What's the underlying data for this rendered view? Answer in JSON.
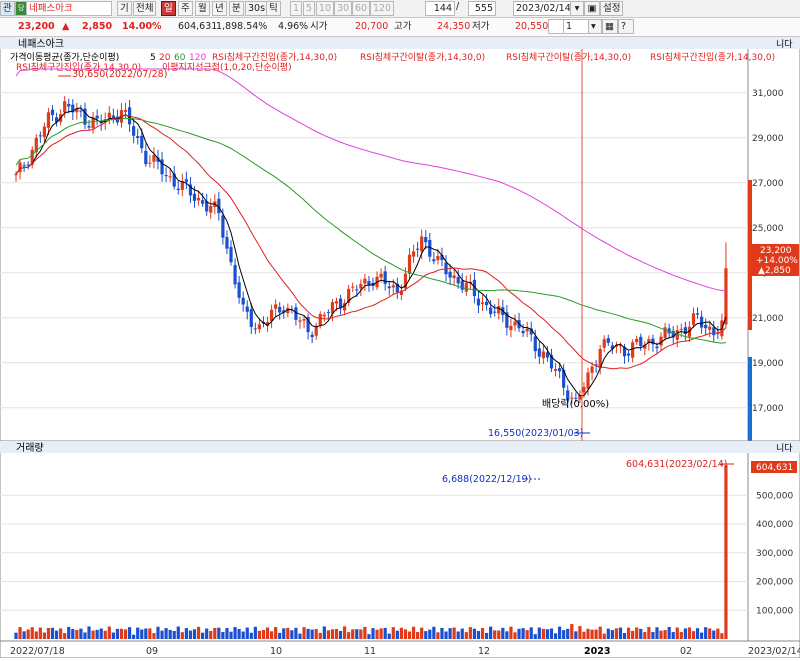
{
  "toolbar": {
    "stock_badge": "관",
    "mode_badge": "당",
    "stock_name": "네패스아크",
    "period_buttons": [
      "기",
      "전체",
      "일",
      "주",
      "월",
      "년",
      "분",
      "30s",
      "틱"
    ],
    "interval_buttons": [
      "1",
      "5",
      "10",
      "30",
      "60",
      "120"
    ],
    "count_shown": "144",
    "count_sep": "/",
    "count_total": "555",
    "date": "2023/02/14",
    "quantity": "1",
    "settings_label": "설정"
  },
  "quote": {
    "price": "23,200",
    "arrow": "▲",
    "change": "2,850",
    "change_pct": "14.00%",
    "volume": "604,631",
    "volume_ratio": "1,898.54%",
    "turnover_pct": "4.96%",
    "open_label": "시가",
    "open": "20,700",
    "high_label": "고가",
    "high": "24,350",
    "low_label": "저가",
    "low": "20,550"
  },
  "price_panel": {
    "title": "네패스아크",
    "legend_ma": "가격이동평균(종가,단순이평)",
    "legend_ma_periods": [
      "5",
      "20",
      "60",
      "120"
    ],
    "legend_rsi1": "RSI침체구간진입(종가,14,30,0)",
    "legend_rsi2": "RSI침체구간이탈(종가,14,30,0)",
    "legend_rsi3": "RSI침체구간이탈(종가,14,30,0)",
    "legend_rsi4": "RSI침체구간진입(종가,14,30,0)",
    "legend_rsi5": "RSI침체구간진입(종가,14,30,0)",
    "legend_env": "이평지지선근접(1,0,20,단순이평)",
    "annot_high": "30,650(2022/07/28)",
    "annot_low": "16,550(2023/01/03)",
    "annot_dividend": "배당락(0.00%)",
    "price_tag": "23,200",
    "change_tag": "+14.00%",
    "change_tag2": "▲2,850",
    "corner_label": "니다"
  },
  "volume_panel": {
    "title": "거래량",
    "annot_peak": "604,631(2023/02/14)",
    "annot_prev": "6,688(2022/12/19)",
    "vol_tag": "604,631",
    "corner_label": "니다"
  },
  "x_axis": {
    "labels": [
      "2022/07/18",
      "09",
      "10",
      "11",
      "12",
      "2023",
      "02",
      "2023/02/14"
    ]
  },
  "colors": {
    "up": "#e03a1a",
    "down": "#1a4fd0",
    "ma5": "#000000",
    "ma20": "#e02020",
    "ma60": "#2a9a2a",
    "ma120": "#e040e0"
  },
  "chart_data": [
    {
      "type": "line",
      "title": "네패스아크",
      "ylim": [
        15700,
        31700
      ],
      "yticks": [
        "31,000",
        "29,000",
        "27,000",
        "25,000",
        "23,000",
        "21,000",
        "19,000",
        "17,000"
      ],
      "x": [
        "2022/07/18",
        "2022/09",
        "2022/10",
        "2022/11",
        "2022/12",
        "2023",
        "2023/02",
        "2023/02/14"
      ],
      "series": [
        {
          "name": "5",
          "values": [
            27800,
            30000,
            27300,
            21200,
            21800,
            24400,
            21300,
            18100,
            20000,
            21200,
            23200
          ]
        },
        {
          "name": "20",
          "values": [
            28000,
            29700,
            27900,
            22500,
            21500,
            23200,
            22500,
            19200,
            19300,
            20500,
            21400
          ]
        },
        {
          "name": "60",
          "values": [
            31200,
            30500,
            28500,
            25800,
            24000,
            23300,
            22500,
            21500,
            21000,
            20800,
            20800
          ]
        },
        {
          "name": "120",
          "values": [
            32000,
            31200,
            29500,
            28200,
            27000,
            25800,
            24900,
            24000,
            23100,
            22400,
            22000
          ]
        }
      ],
      "high": 30650,
      "low": 16550,
      "last": 23200
    },
    {
      "type": "bar",
      "title": "거래량",
      "ylim": [
        0,
        640000
      ],
      "yticks": [
        "500,000",
        "400,000",
        "300,000",
        "200,000",
        "100,000"
      ],
      "peak": 604631,
      "marker": 6688
    }
  ]
}
